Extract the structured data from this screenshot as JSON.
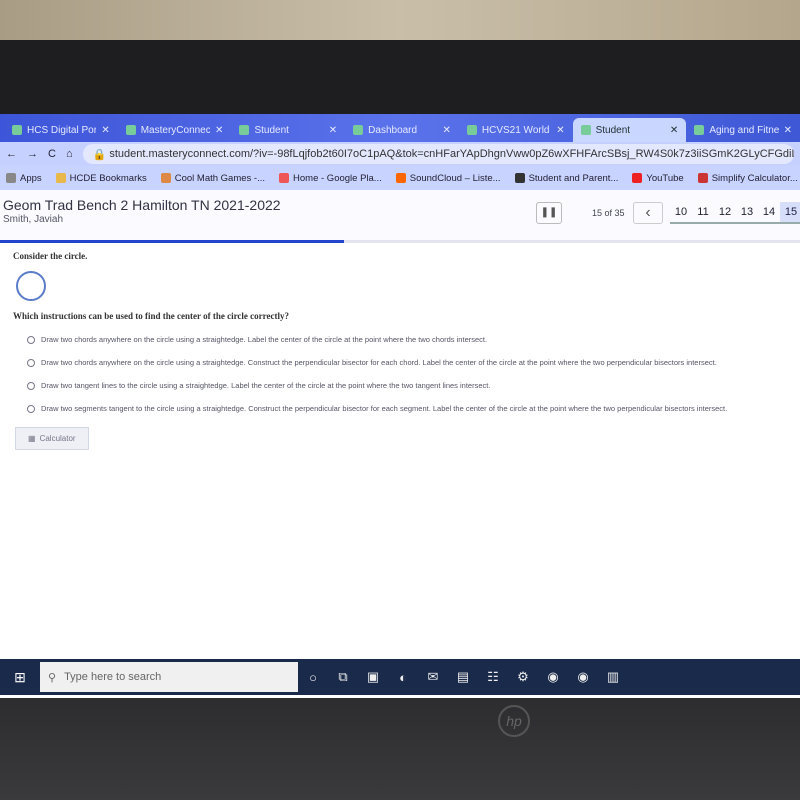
{
  "browser": {
    "tabs": [
      {
        "label": "HCS Digital Porta",
        "active": false
      },
      {
        "label": "MasteryConnect",
        "active": false
      },
      {
        "label": "Student",
        "active": false
      },
      {
        "label": "Dashboard",
        "active": false
      },
      {
        "label": "HCVS21 World",
        "active": false
      },
      {
        "label": "Student",
        "active": true
      },
      {
        "label": "Aging and Fitne",
        "active": false
      }
    ],
    "url": "student.masteryconnect.com/?iv=-98fLqjfob2t60I7oC1pAQ&tok=cnHFarYApDhgnVww0pZ6wXFHFArcSBsj_RW4S0k7z3iiSGmK2GLyCFGdiDkqb6BT4",
    "bookmarks": [
      "Apps",
      "HCDE Bookmarks",
      "Cool Math Games -...",
      "Home - Google Pla...",
      "SoundCloud – Liste...",
      "Student and Parent...",
      "YouTube",
      "Simplify Calculator..."
    ]
  },
  "header": {
    "title": "Geom Trad Bench 2 Hamilton TN 2021-2022",
    "student": "Smith, Javiah",
    "count": "15 of 35",
    "pages": [
      "10",
      "11",
      "12",
      "13",
      "14",
      "15"
    ],
    "current_page": "15",
    "progress_percent": 43
  },
  "question": {
    "prompt": "Consider the circle.",
    "question": "Which instructions can be used to find the center of the circle correctly?",
    "options": [
      "Draw two chords anywhere on the circle using a straightedge. Label the center of the circle at the point where the two chords intersect.",
      "Draw two chords anywhere on the circle using a straightedge. Construct the perpendicular bisector for each chord. Label the center of the circle at the point where the two perpendicular bisectors intersect.",
      "Draw two tangent lines to the circle using a straightedge. Label the center of the circle at the point where the two tangent lines intersect.",
      "Draw two segments tangent to the circle using a straightedge. Construct the perpendicular bisector for each segment. Label the center of the circle at the point where the two perpendicular bisectors intersect."
    ],
    "calculator": "Calculator"
  },
  "taskbar": {
    "search_placeholder": "Type here to search"
  },
  "colors": {
    "accent": "#2244cc",
    "tabbar": "#4a62e0"
  }
}
